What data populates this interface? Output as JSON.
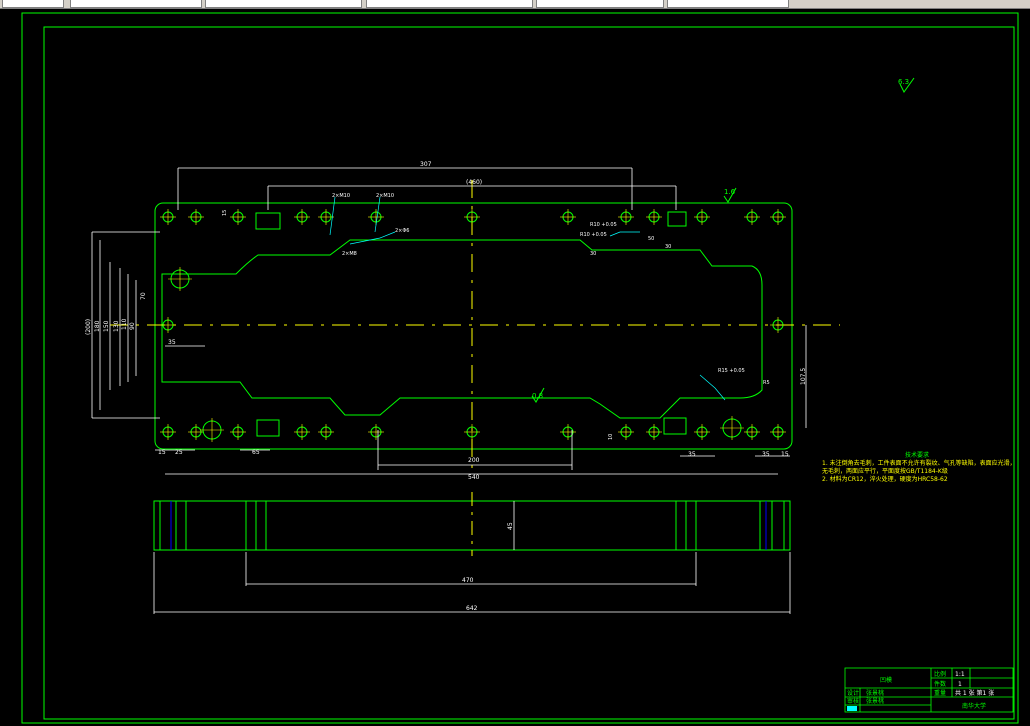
{
  "drawing": {
    "top_view_dims": {
      "overall_width": "642",
      "hole_span": "540",
      "upper_span": "(460)",
      "upper_partial": "307",
      "inner_span": "200",
      "bottom_span": "200",
      "left_offset_small": "10",
      "left_offset_a": "25",
      "left_offset_b": "65",
      "right_offset_a": "35",
      "right_offset_b": "35",
      "right_offset_small": "10",
      "vertical_total": "(200)",
      "vertical_a": "180",
      "vertical_b": "150",
      "vertical_c": "130",
      "vertical_d": "110",
      "vertical_e": "90",
      "vertical_f": "70",
      "pocket_width": "35",
      "right_height": "107.5",
      "left_small": "15",
      "right_small": "15",
      "slot_left_a": "2×M10",
      "slot_left_b": "2×M10",
      "slot_mid_a": "2×M8",
      "slot_mid_b": "2×Φ6",
      "radius_a": "R10 +0.05",
      "radius_b": "R10 +0.05",
      "radius_c": "R15 +0.05",
      "radius_d": "R5",
      "dim_mid_a": "50",
      "dim_mid_b": "30",
      "dim_mid_c": "30",
      "dim_mid_d": "10",
      "chamfer": "15",
      "roughness_top": "1.6",
      "roughness_mid": "0.8",
      "roughness_corner": "6.3"
    },
    "side_view_dims": {
      "overall_width": "642",
      "inner_width": "470",
      "height": "45"
    },
    "notes": {
      "title": "技术要求",
      "line1": "1.  未注倒角去毛刺，工件表面不允许有裂纹、气孔等缺陷，表面应光滑，",
      "line2": "     无毛刺，两面应平行，平面度按GB/T1184-K级",
      "line3": "2.  材料为CR12，淬火处理，硬度为HRC58-62"
    },
    "title_block": {
      "part_name": "凹模",
      "scale_label": "比例",
      "scale_value": "1:1",
      "qty_label": "件数",
      "qty_value": "1",
      "design_label": "设计",
      "design_name": "张景桃",
      "check_label": "审核",
      "check_name": "张景桃",
      "weight_label": "重量",
      "sheet_text": "共 1 张 第1 张",
      "school": "南华大学"
    }
  }
}
